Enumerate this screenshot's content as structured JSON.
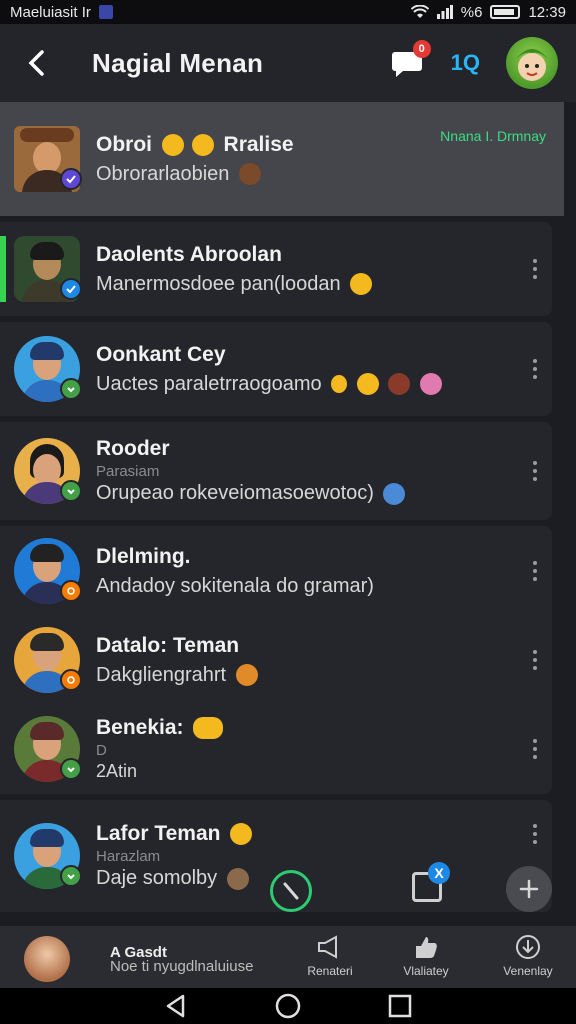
{
  "status_bar": {
    "carrier": "Maeluiasit Ir",
    "battery_text": "%6",
    "time": "12:39"
  },
  "header": {
    "title": "Nagial Menan",
    "chat_badge": "0",
    "search_label": "1Q"
  },
  "chats": [
    {
      "name": "Obroi",
      "name_suffix": "Rralise",
      "message": "Obrorarlaobien",
      "date": "Nnana I. Drmnay",
      "status_color": "#5e48d6",
      "face_bg": "#7a4a2e",
      "shirt": "#3b2a22"
    },
    {
      "name": "Daolents Abroolan",
      "message": "Manermosdoee pan(loodan",
      "status_color": "#1e88e5",
      "face_bg": "#2f4a2f",
      "shirt": "#3d3a2c"
    },
    {
      "name": "Oonkant Cey",
      "message": "Uactes paraletrraogoamo",
      "status_color": "#43a047",
      "face_bg": "#3aa0e0",
      "shirt": "#2f6fbf"
    },
    {
      "name": "Rooder",
      "sub": "Parasiam",
      "message": "Orupeao rokeveiomasoewotoc)",
      "status_color": "#43a047",
      "face_bg": "#e8b04a",
      "shirt": "#4a3a7a"
    },
    {
      "name": "Dlelming.",
      "message": "Andadoy sokitenala do gramar)",
      "status_color": "#f57c00",
      "face_bg": "#1f7bd6",
      "shirt": "#2a2f55"
    },
    {
      "name": "Datalo: Teman",
      "message": "Dakgliengrahrt",
      "status_color": "#f57c00",
      "face_bg": "#e7a63b",
      "shirt": "#2f6fbf"
    },
    {
      "name": "Benekia:",
      "sub": "D",
      "message": "2Atin",
      "status_color": "#43a047",
      "face_bg": "#5a7a3a",
      "shirt": "#7a2a2a"
    },
    {
      "name": "Lafor Teman",
      "sub": "Harazlam",
      "message": "Daje somolby",
      "status_color": "#43a047",
      "face_bg": "#3aa0e0",
      "shirt": "#2a6a3a"
    }
  ],
  "floating": {
    "mid_badge": "X"
  },
  "bottom_nav": {
    "title": "A Gasdt",
    "subtitle": "Noe ti nyugdlnaluiuse",
    "items": [
      {
        "label": "Renateri",
        "icon": "megaphone-icon"
      },
      {
        "label": "Vlaliatey",
        "icon": "thumbs-up-icon"
      },
      {
        "label": "Venenlay",
        "icon": "download-icon"
      }
    ]
  },
  "colors": {
    "accent_green": "#39d353",
    "accent_blue": "#29b6f6",
    "badge_red": "#e53935"
  }
}
